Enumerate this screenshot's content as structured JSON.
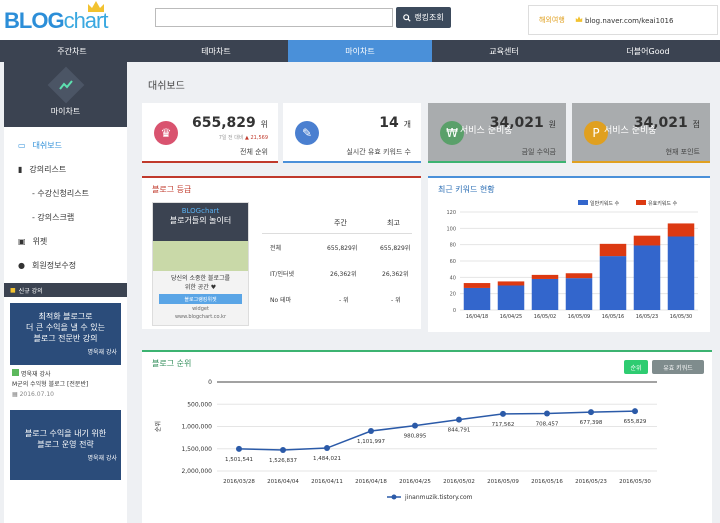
{
  "header": {
    "logo_blog": "BLOG",
    "logo_chart": "chart",
    "search_value": "",
    "search_button": "랭킹조회",
    "user_label": "해외여행",
    "user_url": "blog.naver.com/keai1016"
  },
  "nav": [
    "주간차트",
    "테마차트",
    "마이차트",
    "교육센터",
    "더블어Good"
  ],
  "sidebar": {
    "title": "마이차트",
    "items": [
      {
        "label": "대쉬보드",
        "active": true,
        "sub": false
      },
      {
        "label": "강의리스트",
        "active": false,
        "sub": false
      },
      {
        "label": "- 수강신청리스트",
        "active": false,
        "sub": true
      },
      {
        "label": "- 강의스크랩",
        "active": false,
        "sub": true
      },
      {
        "label": "위젯",
        "active": false,
        "sub": false
      },
      {
        "label": "회원정보수정",
        "active": false,
        "sub": false
      }
    ],
    "new_label": "신규 강의",
    "banner1_lines": [
      "최적화 블로그로",
      "더 큰 수익을 낼 수 있는",
      "블로그 전문반 강의"
    ],
    "banner1_sign": "명욱재 강사",
    "teach1_name": "명욱재 강사",
    "teach1_course": "M군의 수익형 블로그 [전문반]",
    "teach1_date": "2016.07.10",
    "banner2_lines": [
      "블로그 수익을 내기 위한",
      "블로그 운영 전략"
    ],
    "banner2_sign": "명욱재 강사"
  },
  "main": {
    "title": "대쉬보드",
    "stat1": {
      "value": "655,829",
      "unit": "위",
      "sub": "7일 전 대비",
      "delta": "21,569",
      "label": "전체 순위"
    },
    "stat2": {
      "value": "14",
      "unit": "개",
      "label": "실시간 유효 키워드 수"
    },
    "stat3": {
      "value": "34,021",
      "unit": "원",
      "label": "금일 수익금",
      "ribbon": "서비스 준비중"
    },
    "stat4": {
      "value": "34,021",
      "unit": "점",
      "label": "현재 포인트",
      "ribbon": "서비스 준비중"
    },
    "level": {
      "title": "블로그 등급",
      "box_title": "블로거들의 놀이터",
      "box_text": [
        "당신의 소중한 블로그를",
        "위한 공간 ♥"
      ],
      "box_button": "블로그랭킹위젯",
      "box_widget": "widget",
      "box_url": "www.blogchart.co.kr",
      "col_week": "주간",
      "col_best": "최고",
      "rows": [
        {
          "name": "전체",
          "week": "655,829위",
          "best": "655,829위"
        },
        {
          "name": "IT/인터넷",
          "week": "26,362위",
          "best": "26,362위"
        },
        {
          "name": "No 테마",
          "week": "- 위",
          "best": "- 위"
        }
      ]
    },
    "keyword_title": "최근 키워드 현황",
    "rank_title": "블로그 순위",
    "rank_btn1": "순위",
    "rank_btn2": "유효 키워드",
    "rank_ylabel": "순위",
    "colors": {
      "blue": "#3366cc",
      "red": "#dc3912",
      "accent": "#4a90d9",
      "nav": "#3b4351"
    }
  },
  "chart_data": [
    {
      "type": "bar",
      "stacked": true,
      "categories": [
        "16/04/18",
        "16/04/25",
        "16/05/02",
        "16/05/09",
        "16/05/16",
        "16/05/23",
        "16/05/30"
      ],
      "series": [
        {
          "name": "일반키워드 수",
          "values": [
            27,
            30,
            38,
            39,
            66,
            79,
            90
          ]
        },
        {
          "name": "유효키워드 수",
          "values": [
            6,
            5,
            5,
            6,
            15,
            12,
            16
          ]
        }
      ],
      "ylim": [
        0,
        120
      ],
      "yticks": [
        0,
        20,
        40,
        60,
        80,
        100,
        120
      ],
      "legend": "top-right"
    },
    {
      "type": "line",
      "categories": [
        "2016/03/28",
        "2016/04/04",
        "2016/04/11",
        "2016/04/18",
        "2016/04/25",
        "2016/05/02",
        "2016/05/09",
        "2016/05/16",
        "2016/05/23",
        "2016/05/30"
      ],
      "series": [
        {
          "name": "jinanmuzik.tistory.com",
          "values": [
            1501541,
            1526837,
            1484021,
            1101997,
            980895,
            844791,
            717562,
            708457,
            677398,
            655829
          ],
          "labels": [
            "1,501,541",
            "1,526,837",
            "1,484,021",
            "1,101,997",
            "980,895",
            "844,791",
            "717,562",
            "708,457",
            "677,398",
            "655,829"
          ]
        }
      ],
      "ylim": [
        0,
        2000000
      ],
      "yreversed": true,
      "yticks": [
        "0",
        "500,000",
        "1,000,000",
        "1,500,000",
        "2,000,000"
      ],
      "ylabel": "순위",
      "legend": "bottom"
    }
  ]
}
